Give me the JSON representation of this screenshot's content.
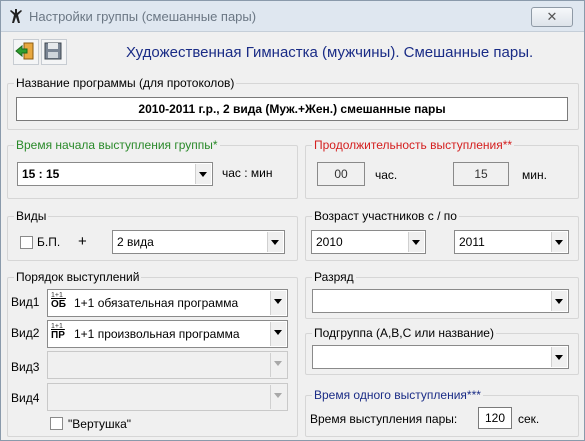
{
  "window": {
    "title": "Настройки группы (смешанные пары)",
    "close_label": "✕"
  },
  "toolbar": {
    "header": "Художественная Гимнастка (мужчины). Смешанные пары."
  },
  "program_name": {
    "legend": "Название программы (для протоколов)",
    "value": "2010-2011 г.р., 2 вида (Муж.+Жен.) смешанные пары"
  },
  "start_time": {
    "legend": "Время начала выступления группы*",
    "value": "15 : 15",
    "unit": "час : мин",
    "legend_color": "#2a8a2a"
  },
  "duration": {
    "legend": "Продолжительность выступления**",
    "hours": "00",
    "hours_label": "час.",
    "minutes": "15",
    "minutes_label": "мин.",
    "legend_color": "#d42020"
  },
  "types": {
    "legend": "Виды",
    "bp_label": "Б.П.",
    "plus": "+",
    "count_value": "2 вида"
  },
  "age": {
    "legend": "Возраст участников с / по",
    "from": "2010",
    "to": "2011"
  },
  "order": {
    "legend": "Порядок выступлений",
    "rows": [
      {
        "label": "Вид1",
        "badge_top": "1+1",
        "badge_bot": "ОБ",
        "value": "1+1 обязательная программа"
      },
      {
        "label": "Вид2",
        "badge_top": "1+1",
        "badge_bot": "ПР",
        "value": "1+1 произвольная программа"
      },
      {
        "label": "Вид3",
        "value": ""
      },
      {
        "label": "Вид4",
        "value": ""
      }
    ],
    "vertushka_label": "\"Вертушка\""
  },
  "rank": {
    "legend": "Разряд",
    "value": ""
  },
  "subgroup": {
    "legend": "Подгруппа (A,B,C или название)",
    "value": ""
  },
  "one_perf": {
    "legend": "Время одного выступления***",
    "label": "Время выступления пары:",
    "value": "120",
    "unit": "сек.",
    "legend_color": "#1a2c86"
  }
}
